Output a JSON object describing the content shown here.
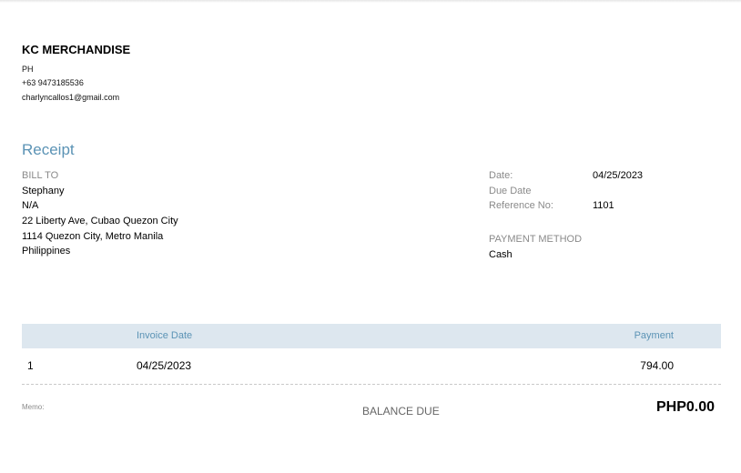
{
  "company": {
    "name": "KC MERCHANDISE",
    "country": "PH",
    "phone": "+63 9473185536",
    "email": "charlyncallos1@gmail.com"
  },
  "document": {
    "title": "Receipt"
  },
  "bill_to": {
    "label": "BILL TO",
    "lines": [
      "Stephany",
      "N/A",
      "22 Liberty Ave, Cubao Quezon City",
      "1114 Quezon City, Metro Manila",
      "Philippines"
    ]
  },
  "details": {
    "date_label": "Date:",
    "date_value": "04/25/2023",
    "due_date_label": "Due Date",
    "due_date_value": "",
    "reference_label": "Reference No:",
    "reference_value": "1101",
    "payment_method_label": "PAYMENT METHOD",
    "payment_method_value": "Cash"
  },
  "table": {
    "headers": {
      "index": "",
      "invoice_date": "Invoice Date",
      "payment": "Payment"
    },
    "rows": [
      {
        "index": "1",
        "invoice_date": "04/25/2023",
        "payment": "794.00"
      }
    ]
  },
  "footer": {
    "memo_label": "Memo:",
    "balance_due_label": "BALANCE DUE",
    "balance_due_value": "PHP0.00"
  },
  "colors": {
    "accent": "#5b93b5",
    "table_header_bg": "#dde7ef",
    "muted_text": "#8a8a8a"
  }
}
